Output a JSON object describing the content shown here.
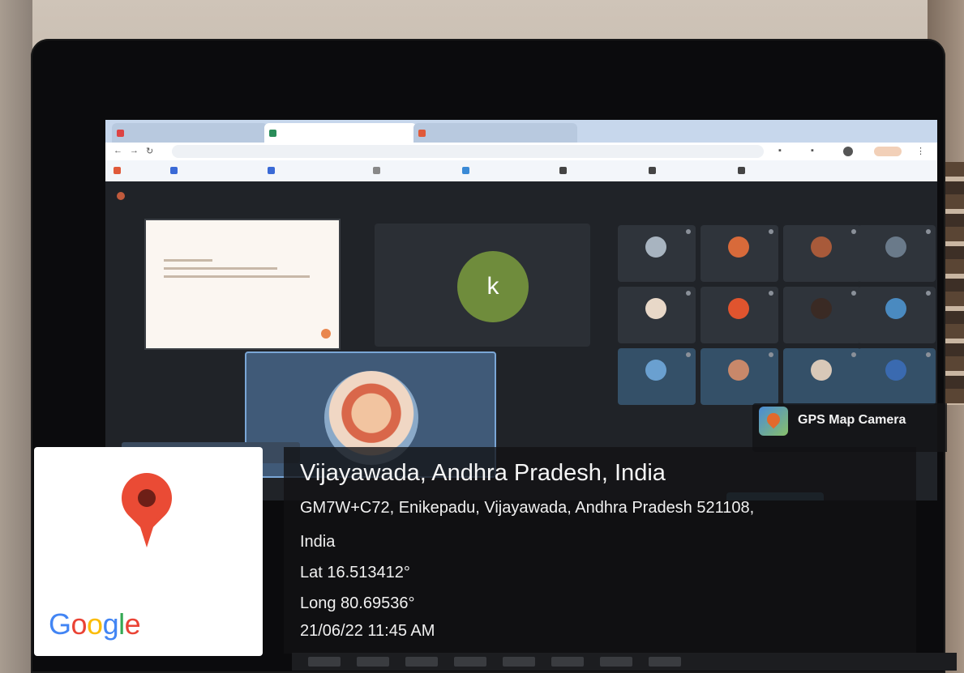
{
  "gps_overlay": {
    "app_name": "GPS Map Camera",
    "city_line": "Vijayawada, Andhra Pradesh, India",
    "address_line_1": "GM7W+C72, Enikepadu, Vijayawada, Andhra Pradesh 521108,",
    "address_line_2": "India",
    "latitude": "Lat 16.513412°",
    "longitude": "Long 80.69536°",
    "timestamp": "21/06/22 11:45 AM",
    "map_logo": [
      "G",
      "o",
      "o",
      "g",
      "l",
      "e"
    ],
    "map_logo_colors": [
      "#4285F4",
      "#EA4335",
      "#FBBC05",
      "#4285F4",
      "#34A853",
      "#EA4335"
    ],
    "pin_color": "#EA4B35"
  },
  "meet": {
    "main_avatar_letter": "k"
  },
  "colors": {
    "presenter_border": "#7AA6D6",
    "avatar_green": "#6F8C3C",
    "accent_orange": "#E9874F"
  }
}
